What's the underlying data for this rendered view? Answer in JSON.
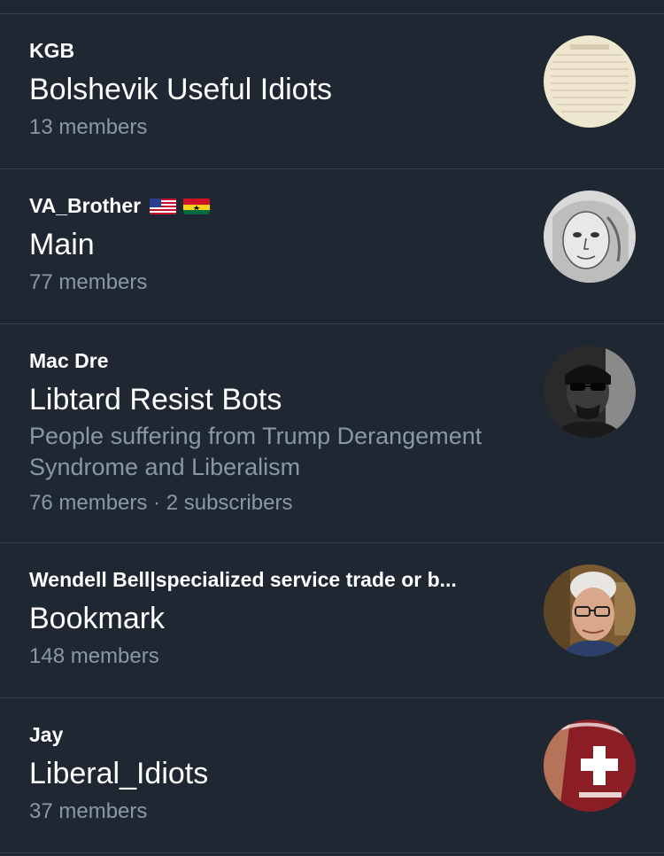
{
  "lists": [
    {
      "owner": "KGB",
      "title": "Bolshevik Useful Idiots",
      "description": "",
      "members": "13 members",
      "subscribers": "",
      "avatar": "parchment-document-avatar"
    },
    {
      "owner": "VA_Brother",
      "owner_flags": [
        "us-flag-icon",
        "ghana-flag-icon"
      ],
      "title": "Main",
      "description": "",
      "members": "77 members",
      "subscribers": "",
      "avatar": "sketch-portrait-avatar"
    },
    {
      "owner": "Mac Dre",
      "title": "Libtard Resist Bots",
      "description": "People suffering from Trump Derangement Syndrome and Liberalism",
      "members": "76 members",
      "separator": " · ",
      "subscribers": "2 subscribers",
      "avatar": "sunglasses-portrait-avatar"
    },
    {
      "owner": "Wendell Bell|specialized service trade or b...",
      "title": "Bookmark",
      "description": "",
      "members": "148 members",
      "subscribers": "",
      "avatar": "older-man-glasses-avatar"
    },
    {
      "owner": "Jay",
      "title": "Liberal_Idiots",
      "description": "",
      "members": "37 members",
      "subscribers": "",
      "avatar": "red-shirt-avatar"
    }
  ],
  "colors": {
    "background": "#1f2733",
    "divider": "#38444d",
    "primary_text": "#ffffff",
    "secondary_text": "#8899a6"
  }
}
